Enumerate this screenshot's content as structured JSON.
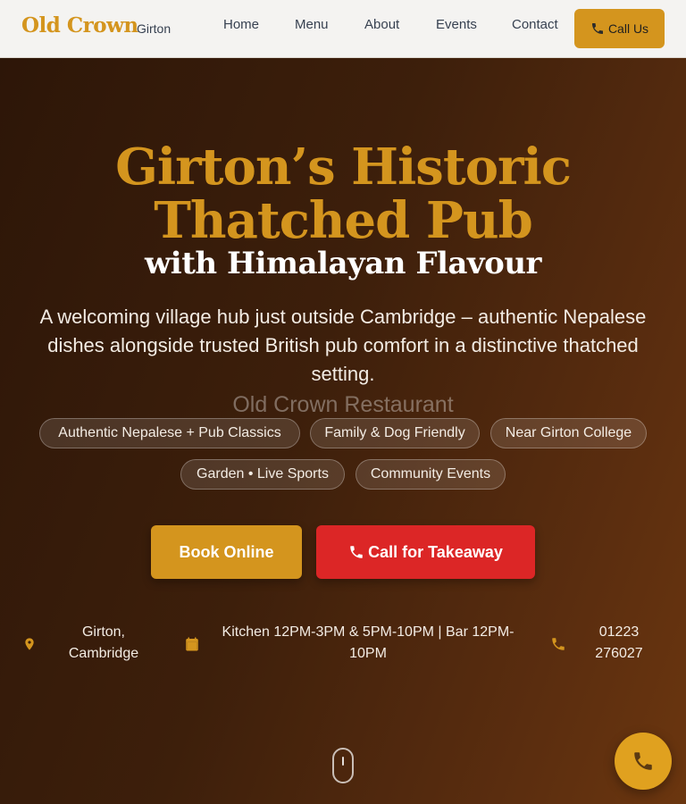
{
  "header": {
    "brand": "Old Crown",
    "brand_sub": "Girton",
    "nav": [
      "Home",
      "Menu",
      "About",
      "Events",
      "Contact"
    ],
    "call_label": "Call Us"
  },
  "hero": {
    "title_line1": "Girton’s Historic",
    "title_line2": "Thatched Pub",
    "title_line3": "with Himalayan Flavour",
    "description": "A welcoming village hub just outside Cambridge – authentic Nepalese dishes alongside trusted British pub comfort in a distinctive thatched setting.",
    "ghost_text": "Old Crown Restaurant",
    "chips": [
      "Authentic Nepalese + Pub Classics",
      "Family & Dog Friendly",
      "Near Girton College",
      "Garden • Live Sports",
      "Community Events"
    ],
    "book_label": "Book Online",
    "takeaway_label": "Call for Takeaway"
  },
  "info": {
    "location": "Girton, Cambridge",
    "hours": "Kitchen 12PM-3PM & 5PM-10PM | Bar 12PM-10PM",
    "phone": "01223 276027"
  },
  "icons": {
    "location": "map-pin-icon",
    "hours": "calendar-icon",
    "phone": "phone-icon",
    "scroll": "scroll-mouse-icon",
    "fab": "phone-icon"
  },
  "colors": {
    "accent": "#d4951e",
    "danger": "#dc2626",
    "header_bg": "#f4f3f1",
    "hero_dark": "#2d1608",
    "hero_light": "#6b360f"
  }
}
